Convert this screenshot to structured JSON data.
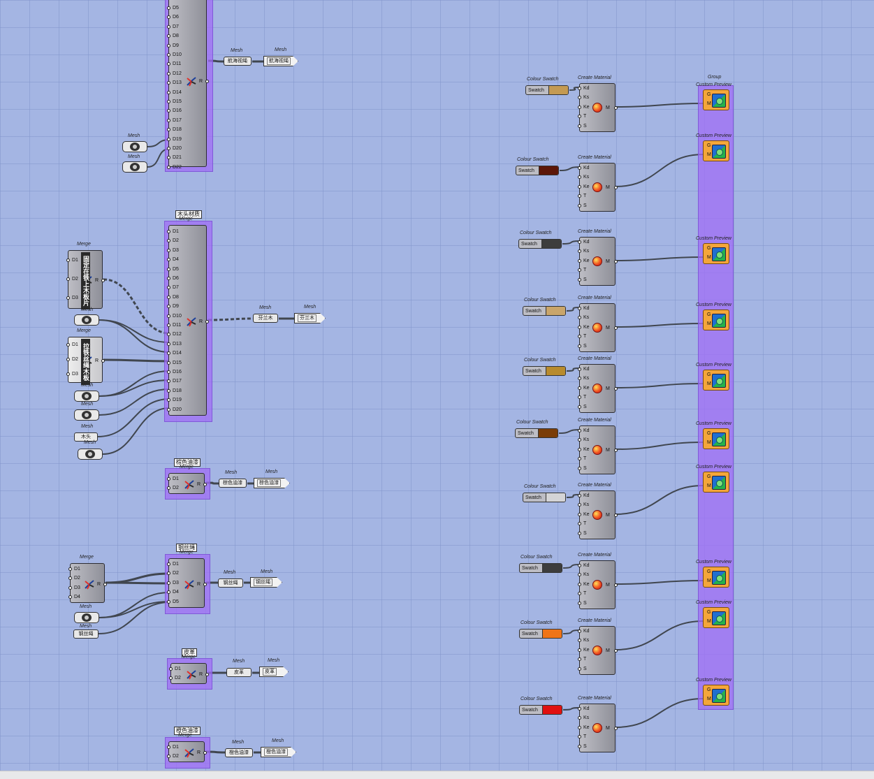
{
  "canvas": {
    "grid_color": "#8296cd",
    "background": "#a4b5e3"
  },
  "merge_large_1": {
    "labels": [
      "D5",
      "D6",
      "D7",
      "D8",
      "D9",
      "D10",
      "D11",
      "D12",
      "D13",
      "D14",
      "D15",
      "D16",
      "D17",
      "D18",
      "D19",
      "D20",
      "D21",
      "D22"
    ],
    "output": "R",
    "mesh_caption_a": "Mesh",
    "mesh_caption_b": "Mesh",
    "out_mesh_title": "Mesh",
    "out_mesh_value": "航海视绳",
    "out_panel_title": "Mesh",
    "out_panel_value": "航海视绳"
  },
  "wood_group": {
    "group_label": "木头材质",
    "merge_title": "Merge",
    "labels": [
      "D1",
      "D2",
      "D3",
      "D4",
      "D5",
      "D6",
      "D7",
      "D8",
      "D9",
      "D10",
      "D11",
      "D12",
      "D13",
      "D14",
      "D15",
      "D16",
      "D17",
      "D18",
      "D19",
      "D20"
    ],
    "output": "R",
    "out_mesh_title": "Mesh",
    "out_mesh_value": "芬兰木",
    "out_panel_title": "Mesh",
    "out_panel_value": "芬兰木",
    "sub_merge_1": {
      "title": "Merge",
      "labels": [
        "D1",
        "D2",
        "D3"
      ],
      "output": "R",
      "vertical_text": "固定在铁上木板片"
    },
    "sub_merge_2": {
      "title": "Merge",
      "labels": [
        "D1",
        "D2",
        "D3"
      ],
      "output": "R",
      "vertical_text": "拉铁丝绳木板"
    },
    "mesh_captions": [
      "Mesh",
      "Mesh",
      "Mesh",
      "Mesh",
      "Mesh"
    ],
    "wood_param": "木头"
  },
  "brown_group": {
    "group_label": "棕色油漆",
    "merge_title": "Merge",
    "labels": [
      "D1",
      "D2"
    ],
    "output": "R",
    "out_mesh_title": "Mesh",
    "out_mesh_value": "棕色油漆",
    "out_panel_title": "Mesh",
    "out_panel_value": "棕色油漆"
  },
  "wire_group": {
    "group_label": "钢丝绳",
    "merge_title": "Merge",
    "labels": [
      "D1",
      "D2",
      "D3",
      "D4",
      "D5"
    ],
    "output": "R",
    "out_mesh_title": "Mesh",
    "out_mesh_value": "钢丝绳",
    "out_panel_title": "Mesh",
    "out_panel_value": "钢丝绳",
    "sub_merge": {
      "title": "Merge",
      "labels": [
        "D1",
        "D2",
        "D3",
        "D4"
      ],
      "output": "R"
    },
    "mesh_caption": "Mesh",
    "wire_param_caption": "Mesh",
    "wire_param": "钢丝绳"
  },
  "leather_group": {
    "group_label": "皮革",
    "merge_title": "Merge",
    "labels": [
      "D1",
      "D2"
    ],
    "output": "R",
    "out_mesh_title": "Mesh",
    "out_mesh_value": "皮革",
    "out_panel_title": "Mesh",
    "out_panel_value": "皮革"
  },
  "orange_group": {
    "group_label": "橙色油漆",
    "merge_title": "Merge",
    "labels": [
      "D1",
      "D2"
    ],
    "output": "R",
    "out_mesh_title": "Mesh",
    "out_mesh_value": "橙色油漆",
    "out_panel_title": "Mesh",
    "out_panel_value": "橙色油漆"
  },
  "materials": {
    "swatch_title": "Colour Swatch",
    "swatch_label": "Swatch",
    "create_title": "Create Material",
    "inputs": [
      "Kd",
      "Ks",
      "Ke",
      "T",
      "S"
    ],
    "output": "M",
    "preview_title": "Custom Preview",
    "preview_inputs": [
      "G",
      "M"
    ],
    "group_label": "Group",
    "colors": [
      "#c49a52",
      "#5c1608",
      "#3d3d3d",
      "#c9a56a",
      "#b88b2e",
      "#7a3d08",
      "#d4d4d6",
      "#3d3d3d",
      "#ef7418",
      "#e01010"
    ]
  }
}
